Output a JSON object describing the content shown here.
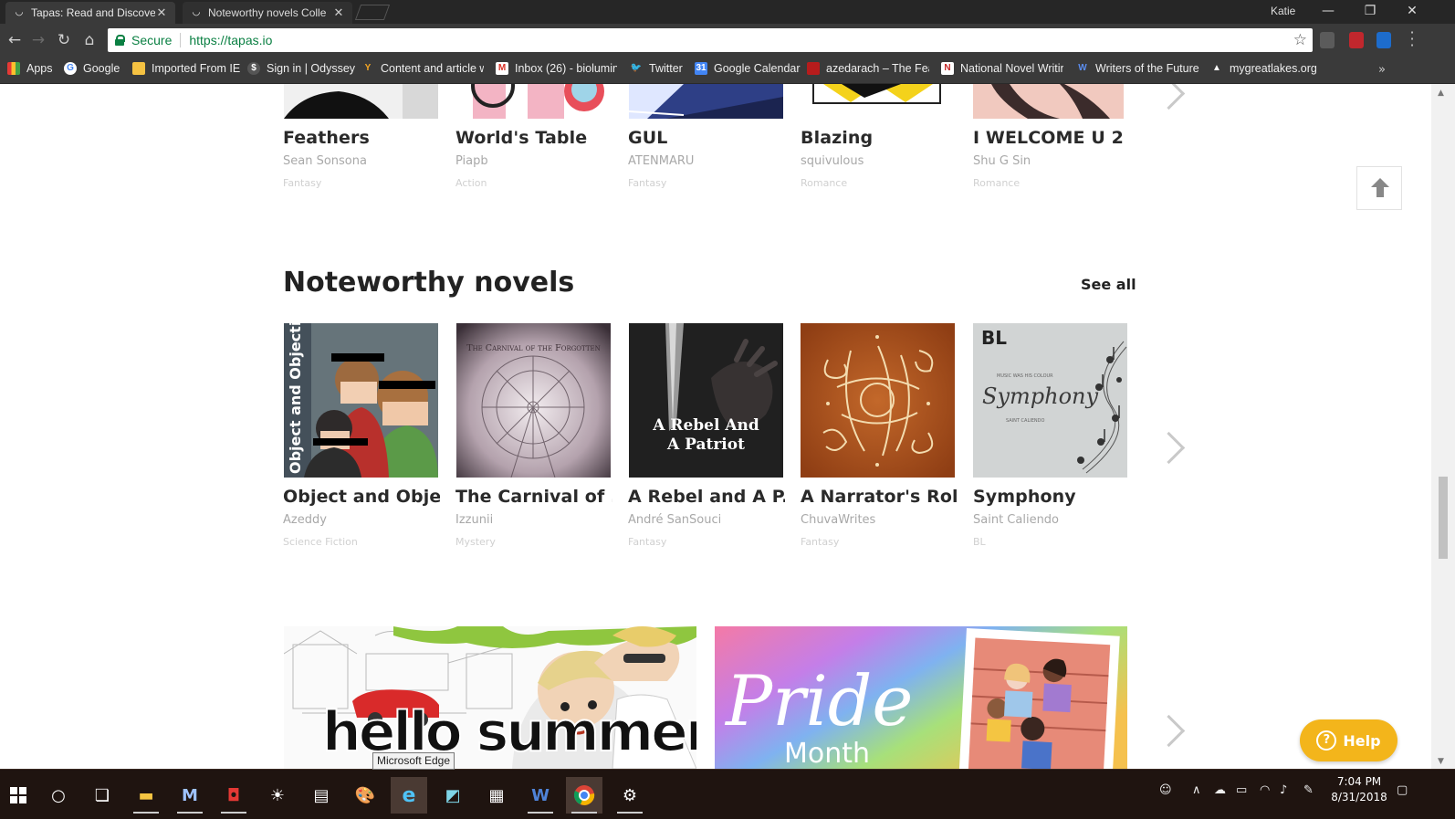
{
  "browser": {
    "tabs": [
      {
        "title": "Tapas: Read and Discover",
        "active": true
      },
      {
        "title": "Noteworthy novels Colle",
        "active": false
      }
    ],
    "profile": "Katie",
    "address": {
      "secure_label": "Secure",
      "url": "https://tapas.io"
    },
    "bookmarks": [
      {
        "label": "Apps",
        "icon": "apps-grid-icon"
      },
      {
        "label": "Google",
        "icon": "google-icon"
      },
      {
        "label": "Imported From IE",
        "icon": "folder-icon"
      },
      {
        "label": "Sign in | Odyssey",
        "icon": "odyssey-icon"
      },
      {
        "label": "Content and article w",
        "icon": "content-icon"
      },
      {
        "label": "Inbox (26) - biolumin",
        "icon": "gmail-icon"
      },
      {
        "label": "Twitter",
        "icon": "twitter-icon"
      },
      {
        "label": "Google Calendar",
        "icon": "calendar-icon"
      },
      {
        "label": "azedarach – The Feat",
        "icon": "azedarach-icon"
      },
      {
        "label": "National Novel Writir",
        "icon": "nanowrimo-icon"
      },
      {
        "label": "Writers of the Future",
        "icon": "w-icon"
      },
      {
        "label": "mygreatlakes.org",
        "icon": "mountain-icon"
      }
    ]
  },
  "top_row": [
    {
      "title": "Feathers",
      "author": "Sean Sonsona",
      "genre": "Fantasy"
    },
    {
      "title": "World's Table",
      "author": "Piapb",
      "genre": "Action"
    },
    {
      "title": "GUL",
      "author": "ATENMARU",
      "genre": "Fantasy"
    },
    {
      "title": "Blazing",
      "author": "squivulous",
      "genre": "Romance"
    },
    {
      "title": "I WELCOME U 2 ...",
      "author": "Shu G Sin",
      "genre": "Romance"
    }
  ],
  "section": {
    "title": "Noteworthy novels",
    "see_all": "See all"
  },
  "novels": [
    {
      "title": "Object and Obje...",
      "author": "Azeddy",
      "genre": "Science Fiction",
      "cover_text": "Object and Objective"
    },
    {
      "title": "The Carnival of ...",
      "author": "Izzunii",
      "genre": "Mystery",
      "cover_text": "The Carnival of the Forgotten"
    },
    {
      "title": "A Rebel and A P...",
      "author": "André SanSouci",
      "genre": "Fantasy",
      "cover_text": "A Rebel And A Patriot"
    },
    {
      "title": "A Narrator's Role",
      "author": "ChuvaWrites",
      "genre": "Fantasy",
      "cover_text": ""
    },
    {
      "title": "Symphony",
      "author": "Saint Caliendo",
      "genre": "BL",
      "cover_text": "Symphony",
      "cover_badge": "BL",
      "cover_small": "MUSIC WAS HIS COLOUR",
      "cover_credit": "SAINT CALIENDO"
    }
  ],
  "banners": [
    {
      "text": "hello summer"
    },
    {
      "text": "Pride",
      "subtext": "Month"
    }
  ],
  "help_label": "Help",
  "tooltip": "Microsoft Edge",
  "clock": {
    "time": "7:04 PM",
    "date": "8/31/2018"
  }
}
